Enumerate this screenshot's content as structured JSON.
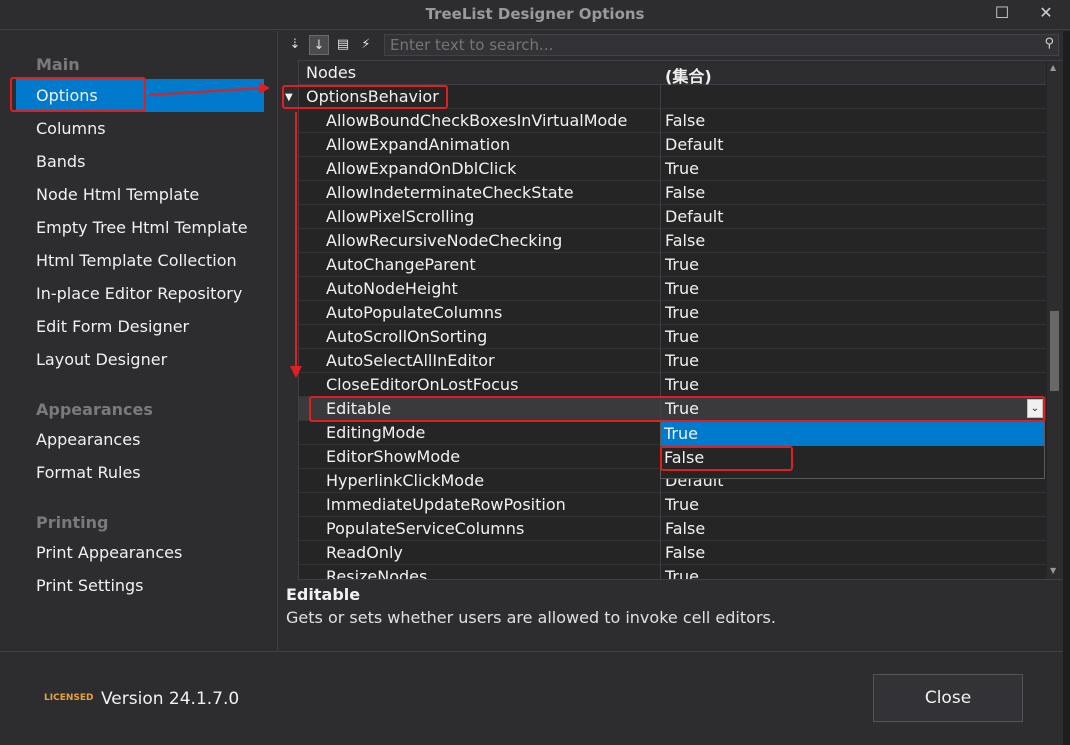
{
  "window": {
    "title": "TreeList Designer Options",
    "maximize_icon": "maximize-icon",
    "close_icon": "close-icon"
  },
  "sidebar": {
    "groups": [
      {
        "title": "Main",
        "items": [
          "Options",
          "Columns",
          "Bands",
          "Node Html Template",
          "Empty Tree Html Template",
          "Html Template Collection",
          "In-place Editor Repository",
          "Edit Form Designer",
          "Layout Designer"
        ]
      },
      {
        "title": "Appearances",
        "items": [
          "Appearances",
          "Format Rules"
        ]
      },
      {
        "title": "Printing",
        "items": [
          "Print Appearances",
          "Print Settings"
        ]
      }
    ],
    "selected": "Options"
  },
  "toolbar": {
    "search_placeholder": "Enter text to search..."
  },
  "grid": {
    "col_name": "Nodes",
    "col_value": "(集合)",
    "category": "OptionsBehavior",
    "rows": [
      {
        "name": "AllowBoundCheckBoxesInVirtualMode",
        "value": "False"
      },
      {
        "name": "AllowExpandAnimation",
        "value": "Default"
      },
      {
        "name": "AllowExpandOnDblClick",
        "value": "True"
      },
      {
        "name": "AllowIndeterminateCheckState",
        "value": "False"
      },
      {
        "name": "AllowPixelScrolling",
        "value": "Default"
      },
      {
        "name": "AllowRecursiveNodeChecking",
        "value": "False"
      },
      {
        "name": "AutoChangeParent",
        "value": "True"
      },
      {
        "name": "AutoNodeHeight",
        "value": "True"
      },
      {
        "name": "AutoPopulateColumns",
        "value": "True"
      },
      {
        "name": "AutoScrollOnSorting",
        "value": "True"
      },
      {
        "name": "AutoSelectAllInEditor",
        "value": "True"
      },
      {
        "name": "CloseEditorOnLostFocus",
        "value": "True"
      },
      {
        "name": "Editable",
        "value": "True"
      },
      {
        "name": "EditingMode",
        "value": ""
      },
      {
        "name": "EditorShowMode",
        "value": ""
      },
      {
        "name": "HyperlinkClickMode",
        "value": "Default"
      },
      {
        "name": "ImmediateUpdateRowPosition",
        "value": "True"
      },
      {
        "name": "PopulateServiceColumns",
        "value": "False"
      },
      {
        "name": "ReadOnly",
        "value": "False"
      },
      {
        "name": "ResizeNodes",
        "value": "True"
      }
    ],
    "dropdown_options": [
      "True",
      "False"
    ]
  },
  "description": {
    "title": "Editable",
    "text": "Gets or sets whether users are allowed to invoke cell editors."
  },
  "footer": {
    "license": "LICENSED",
    "version": "Version 24.1.7.0",
    "close_label": "Close"
  },
  "colors": {
    "accent": "#007acc",
    "annotation": "#e02020",
    "background": "#2d2d30"
  }
}
